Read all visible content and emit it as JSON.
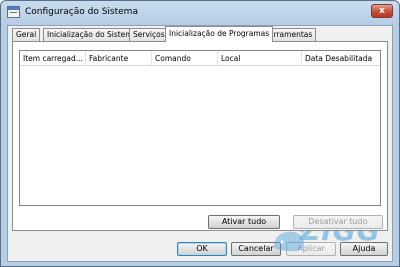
{
  "window": {
    "title": "Configuração do Sistema",
    "close_glyph": "x"
  },
  "tabs": [
    {
      "label": "Geral",
      "active": false
    },
    {
      "label": "Inicialização do Sistema",
      "active": false
    },
    {
      "label": "Serviços",
      "active": false
    },
    {
      "label": "Inicialização de Programas",
      "active": true
    },
    {
      "label": "Ferramentas",
      "active": false
    }
  ],
  "list": {
    "columns": [
      "Item carregad...",
      "Fabricante",
      "Comando",
      "Local",
      "Data Desabilitada"
    ],
    "rows": []
  },
  "panel_buttons": {
    "enable_all": "Ativar tudo",
    "disable_all": "Desativar tudo"
  },
  "dialog_buttons": {
    "ok": "OK",
    "cancel": "Cancelar",
    "apply": "Aplicar",
    "help": "Ajuda"
  },
  "watermark": {
    "text": "ZIGG"
  },
  "colors": {
    "title_gradient_top": "#c9dcee",
    "client_bg": "#f0f0f0",
    "close_red": "#c7513d",
    "watermark_blue": "#46a0dc"
  }
}
